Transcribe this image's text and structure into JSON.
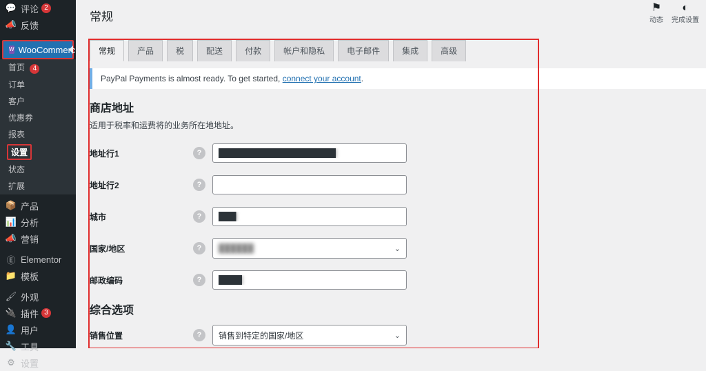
{
  "sidebar": {
    "top": [
      {
        "icon": "💬",
        "label": "评论",
        "badge": "2"
      },
      {
        "icon": "📣",
        "label": "反馈"
      }
    ],
    "woocommerce_label": "WooCommerce",
    "submenu": [
      {
        "label": "首页",
        "badge": "4"
      },
      {
        "label": "订单"
      },
      {
        "label": "客户"
      },
      {
        "label": "优惠券"
      },
      {
        "label": "报表"
      },
      {
        "label": "设置",
        "current": true
      },
      {
        "label": "状态"
      },
      {
        "label": "扩展"
      }
    ],
    "bottom": [
      {
        "icon": "📦",
        "label": "产品"
      },
      {
        "icon": "📊",
        "label": "分析"
      },
      {
        "icon": "📣",
        "label": "营销"
      },
      {
        "icon": "Ⓔ",
        "label": "Elementor"
      },
      {
        "icon": "📁",
        "label": "模板"
      },
      {
        "icon": "🖌",
        "label": "外观"
      },
      {
        "icon": "🔌",
        "label": "插件",
        "badge": "3"
      },
      {
        "icon": "👤",
        "label": "用户"
      },
      {
        "icon": "🔧",
        "label": "工具"
      },
      {
        "icon": "⚙",
        "label": "设置"
      }
    ]
  },
  "header": {
    "title": "常规",
    "right": [
      {
        "icon": "⚑",
        "label": "动态"
      },
      {
        "icon": "◐",
        "label": "完成设置"
      }
    ]
  },
  "tabs": [
    {
      "label": "常规",
      "active": true
    },
    {
      "label": "产品"
    },
    {
      "label": "税"
    },
    {
      "label": "配送"
    },
    {
      "label": "付款"
    },
    {
      "label": "帐户和隐私"
    },
    {
      "label": "电子邮件"
    },
    {
      "label": "集成"
    },
    {
      "label": "高级"
    }
  ],
  "notice": {
    "text_before": "PayPal Payments is almost ready. To get started, ",
    "link": "connect your account",
    "text_after": "."
  },
  "section1": {
    "heading": "商店地址",
    "desc": "适用于税率和运费将的业务所在地地址。",
    "rows": {
      "addr1_label": "地址行1",
      "addr1_value": "████████████████████",
      "addr2_label": "地址行2",
      "addr2_value": "",
      "city_label": "城市",
      "city_value": "███",
      "country_label": "国家/地区",
      "country_value": "██████",
      "postcode_label": "邮政编码",
      "postcode_value": "████"
    }
  },
  "section2": {
    "heading": "综合选项",
    "rows": {
      "sell_to_label": "销售位置",
      "sell_to_value": "销售到特定的国家/地区"
    }
  }
}
